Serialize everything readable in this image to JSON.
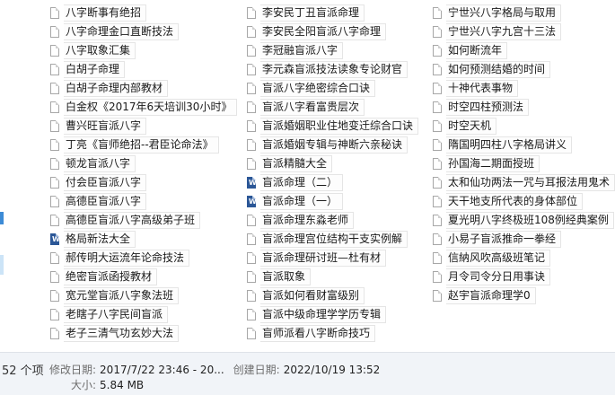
{
  "files": {
    "col1": [
      {
        "name": "八字断事有绝招",
        "icon": "file"
      },
      {
        "name": "八字命理金口直断技法",
        "icon": "file"
      },
      {
        "name": "八字取象汇集",
        "icon": "file"
      },
      {
        "name": "白胡子命理",
        "icon": "file"
      },
      {
        "name": "白胡子命理内部教材",
        "icon": "file"
      },
      {
        "name": "白金权《2017年6天培训30小时》",
        "icon": "file"
      },
      {
        "name": "曹兴旺盲派八字",
        "icon": "file"
      },
      {
        "name": "丁亮《盲师绝招--君臣论命法》",
        "icon": "file"
      },
      {
        "name": "顿龙盲派八字",
        "icon": "file"
      },
      {
        "name": "付会臣盲派八字",
        "icon": "file"
      },
      {
        "name": "高德臣盲派八字",
        "icon": "file"
      },
      {
        "name": "高德臣盲派八字高级弟子班",
        "icon": "file"
      },
      {
        "name": "格局新法大全",
        "icon": "doc"
      },
      {
        "name": "郝传明大运流年论命技法",
        "icon": "file"
      },
      {
        "name": "绝密盲派函授教材",
        "icon": "file"
      },
      {
        "name": "宽元堂盲派八字象法班",
        "icon": "file"
      },
      {
        "name": "老瞎子八字民间盲派",
        "icon": "file"
      },
      {
        "name": "老子三清气功玄妙大法",
        "icon": "file"
      }
    ],
    "col2": [
      {
        "name": "李安民丁丑盲派命理",
        "icon": "file"
      },
      {
        "name": "李安民全阳盲派八字命理",
        "icon": "file"
      },
      {
        "name": "李冠融盲派八字",
        "icon": "file"
      },
      {
        "name": "李元森盲派技法读象专论财官",
        "icon": "file"
      },
      {
        "name": "盲派八字绝密综合口诀",
        "icon": "file"
      },
      {
        "name": "盲派八字看富贵层次",
        "icon": "file"
      },
      {
        "name": "盲派婚姻职业住地变迁综合口诀",
        "icon": "file"
      },
      {
        "name": "盲派婚姻专辑与神断六亲秘诀",
        "icon": "file"
      },
      {
        "name": "盲派精髓大全",
        "icon": "file"
      },
      {
        "name": "盲派命理（二）",
        "icon": "doc"
      },
      {
        "name": "盲派命理（一）",
        "icon": "doc"
      },
      {
        "name": "盲派命理东淼老师",
        "icon": "file"
      },
      {
        "name": "盲派命理宫位结构干支实例解",
        "icon": "file"
      },
      {
        "name": "盲派命理研讨班—杜有材",
        "icon": "file"
      },
      {
        "name": "盲派取象",
        "icon": "file"
      },
      {
        "name": "盲派如何看财富级别",
        "icon": "file"
      },
      {
        "name": "盲派中级命理学学历专辑",
        "icon": "file"
      },
      {
        "name": "盲师派看八字断命技巧",
        "icon": "file"
      }
    ],
    "col3": [
      {
        "name": "宁世兴八字格局与取用",
        "icon": "file"
      },
      {
        "name": "宁世兴八字九宫十三法",
        "icon": "file"
      },
      {
        "name": "如何断流年",
        "icon": "file"
      },
      {
        "name": "如何预测结婚的时间",
        "icon": "file"
      },
      {
        "name": "十神代表事物",
        "icon": "file"
      },
      {
        "name": "时空四柱预测法",
        "icon": "file"
      },
      {
        "name": "时空天机",
        "icon": "file"
      },
      {
        "name": "隋国明四柱八字格局讲义",
        "icon": "file"
      },
      {
        "name": "孙国海二期面授班",
        "icon": "file"
      },
      {
        "name": "太和仙功两法一咒与耳报法用鬼术",
        "icon": "file"
      },
      {
        "name": "天干地支所代表的身体部位",
        "icon": "file"
      },
      {
        "name": "夏光明八字终极班108例经典案例",
        "icon": "file"
      },
      {
        "name": "小易子盲派推命一拳经",
        "icon": "file"
      },
      {
        "name": "信納风吹高级班笔记",
        "icon": "file"
      },
      {
        "name": "月令司令分日用事诀",
        "icon": "file"
      },
      {
        "name": "赵宇盲派命理学0",
        "icon": "file"
      }
    ]
  },
  "details": {
    "count": "52 个项",
    "modified_label": "修改日期:",
    "modified_value": "2017/7/22 23:46 - 20...",
    "created_label": "创建日期:",
    "created_value": "2022/10/19 13:52",
    "size_label": "大小:",
    "size_value": "5.84 MB"
  }
}
